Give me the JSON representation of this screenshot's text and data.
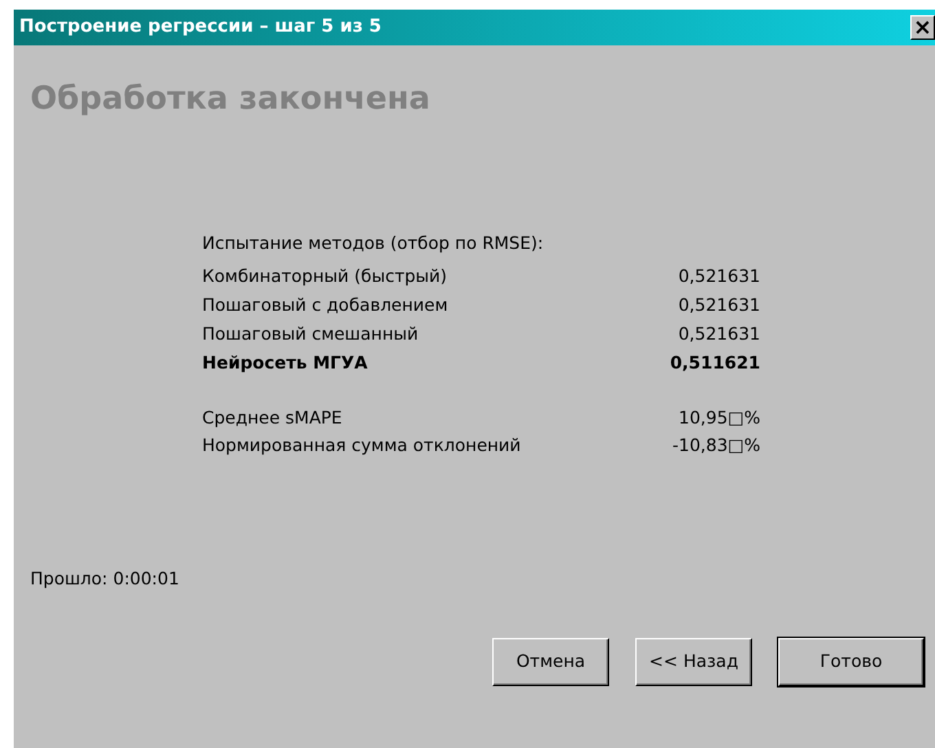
{
  "window": {
    "title": "Построение регрессии – шаг 5 из 5",
    "close": "×"
  },
  "heading": "Обработка закончена",
  "methods_caption": "Испытание методов (отбор по RMSE):",
  "methods": [
    {
      "name": "Комбинаторный (быстрый)",
      "value": "0,521631",
      "best": false
    },
    {
      "name": "Пошаговый с добавлением",
      "value": "0,521631",
      "best": false
    },
    {
      "name": "Пошаговый смешанный",
      "value": "0,521631",
      "best": false
    },
    {
      "name": "Нейросеть МГУА",
      "value": "0,511621",
      "best": true
    }
  ],
  "metrics": [
    {
      "name": "Среднее sMAPE",
      "value": "10,95□%"
    },
    {
      "name": "Нормированная сумма отклонений",
      "value": "-10,83□%"
    }
  ],
  "elapsed": "Прошло: 0:00:01",
  "buttons": [
    {
      "label": "Отмена",
      "default": false
    },
    {
      "label": "<< Назад",
      "default": false
    },
    {
      "label": "Готово",
      "default": true
    }
  ]
}
